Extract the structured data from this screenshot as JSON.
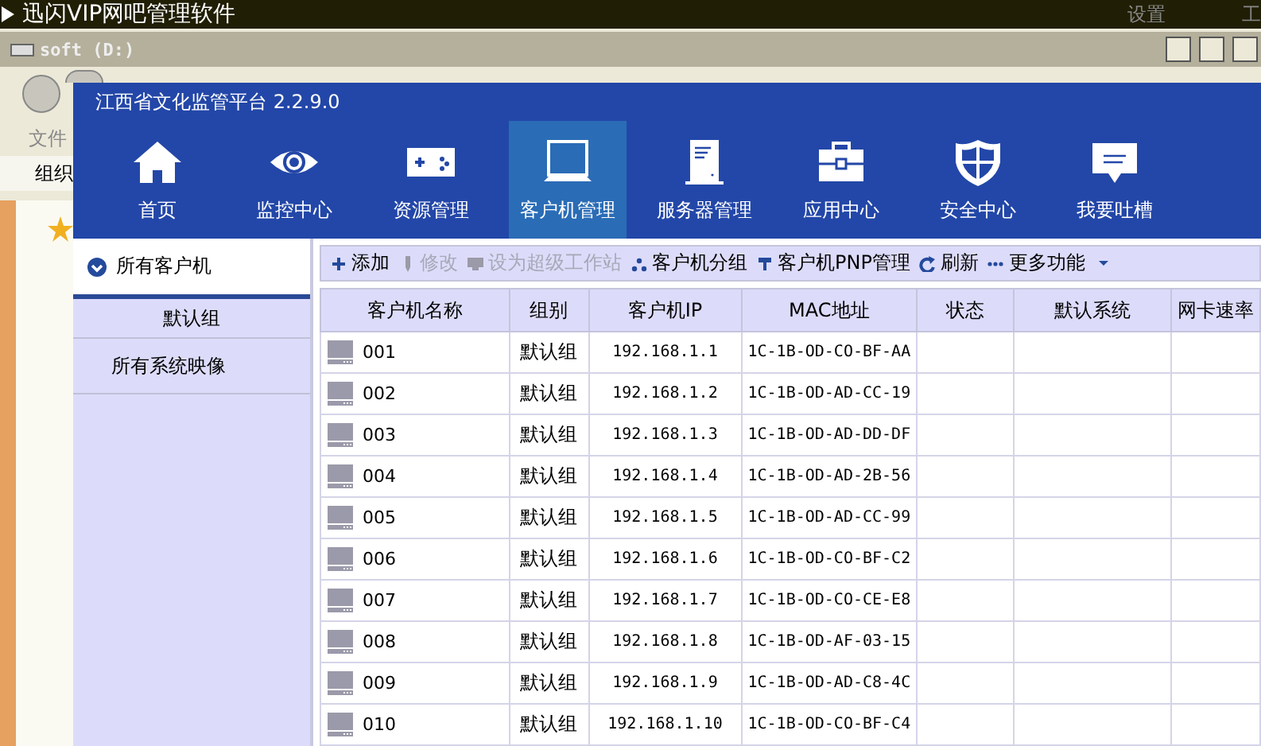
{
  "taskbar": {
    "title": "迅闪VIP网吧管理软件",
    "menu": [
      "设置",
      "工"
    ]
  },
  "explorer": {
    "title": "soft (D:)",
    "menu": [
      "文件"
    ],
    "toolbar": [
      "组织"
    ]
  },
  "app": {
    "title": "江西省文化监管平台 2.2.9.0",
    "nav": [
      {
        "label": "首页",
        "selected": false
      },
      {
        "label": "监控中心",
        "selected": false
      },
      {
        "label": "资源管理",
        "selected": false
      },
      {
        "label": "客户机管理",
        "selected": true
      },
      {
        "label": "服务器管理",
        "selected": false
      },
      {
        "label": "应用中心",
        "selected": false
      },
      {
        "label": "安全中心",
        "selected": false
      },
      {
        "label": "我要吐槽",
        "selected": false
      }
    ],
    "sidebar": [
      {
        "label": "所有客户机",
        "expanded": true,
        "children": [
          {
            "label": "默认组"
          }
        ]
      },
      {
        "label": "所有系统映像"
      }
    ],
    "toolbar": [
      {
        "label": "添加",
        "kind": "button",
        "disabled": false
      },
      {
        "label": "修改",
        "kind": "button",
        "disabled": true
      },
      {
        "label": "设为超级工作站",
        "kind": "button",
        "disabled": true
      },
      {
        "label": "客户机分组",
        "kind": "button",
        "disabled": false
      },
      {
        "label": "客户机PNP管理",
        "kind": "button",
        "disabled": false
      },
      {
        "label": "刷新",
        "kind": "button",
        "disabled": false
      },
      {
        "label": "更多功能",
        "kind": "menu",
        "disabled": false
      }
    ],
    "table": {
      "columns": [
        "客户机名称",
        "组别",
        "客户机IP",
        "MAC地址",
        "状态",
        "默认系统",
        "网卡速率"
      ],
      "rows": [
        {
          "name": "001",
          "group": "默认组",
          "ip": "192.168.1.1",
          "mac": "1C-1B-OD-CO-BF-AA"
        },
        {
          "name": "002",
          "group": "默认组",
          "ip": "192.168.1.2",
          "mac": "1C-1B-OD-AD-CC-19"
        },
        {
          "name": "003",
          "group": "默认组",
          "ip": "192.168.1.3",
          "mac": "1C-1B-OD-AD-DD-DF"
        },
        {
          "name": "004",
          "group": "默认组",
          "ip": "192.168.1.4",
          "mac": "1C-1B-OD-AD-2B-56"
        },
        {
          "name": "005",
          "group": "默认组",
          "ip": "192.168.1.5",
          "mac": "1C-1B-OD-AD-CC-99"
        },
        {
          "name": "006",
          "group": "默认组",
          "ip": "192.168.1.6",
          "mac": "1C-1B-OD-CO-BF-C2"
        },
        {
          "name": "007",
          "group": "默认组",
          "ip": "192.168.1.7",
          "mac": "1C-1B-OD-CO-CE-E8"
        },
        {
          "name": "008",
          "group": "默认组",
          "ip": "192.168.1.8",
          "mac": "1C-1B-OD-AF-03-15"
        },
        {
          "name": "009",
          "group": "默认组",
          "ip": "192.168.1.9",
          "mac": "1C-1B-OD-AD-C8-4C"
        },
        {
          "name": "010",
          "group": "默认组",
          "ip": "192.168.1.10",
          "mac": "1C-1B-OD-CO-BF-C4"
        }
      ]
    }
  }
}
